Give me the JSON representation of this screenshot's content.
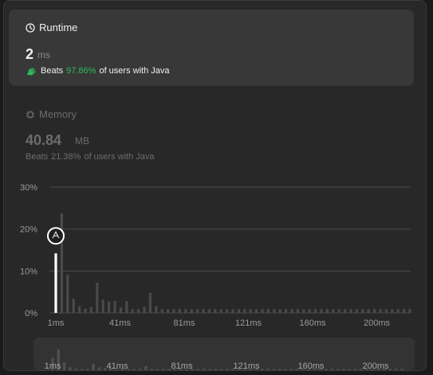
{
  "runtime": {
    "title": "Runtime",
    "value": "2",
    "unit": "ms",
    "beats_label": "Beats",
    "beats_pct": "97.86%",
    "beats_suffix": "of users with Java"
  },
  "memory": {
    "title": "Memory",
    "value": "40.84",
    "unit": "MB",
    "beats_label": "Beats",
    "beats_pct": "21.38%",
    "beats_suffix": "of users with Java"
  },
  "colors": {
    "accent_green": "#2cbb5d",
    "bar": "#4a4a4a",
    "highlight": "#ffffff"
  },
  "icons": {
    "runtime": "clock-icon",
    "memory": "chip-icon",
    "beats": "hand-clap-icon",
    "marker": "user-avatar-icon"
  },
  "chart_data": {
    "type": "bar",
    "xlabel": "",
    "ylabel": "",
    "ylim": [
      0,
      30
    ],
    "yticks": [
      "30%",
      "20%",
      "10%",
      "0%"
    ],
    "xticks": [
      "1ms",
      "41ms",
      "81ms",
      "121ms",
      "160ms",
      "200ms"
    ],
    "highlight_index": 0,
    "series": [
      {
        "values": [
          14.2,
          23.7,
          9.1,
          3.4,
          1.6,
          1.0,
          1.4,
          7.2,
          3.2,
          2.7,
          2.9,
          1.3,
          2.8,
          0.9,
          0.9,
          1.4,
          4.8,
          1.6,
          0.9,
          0.9,
          0.9,
          0.9,
          0.9,
          0.9,
          0.9,
          0.9,
          0.9,
          0.9,
          0.9,
          0.9,
          0.9,
          0.9,
          0.9,
          0.9,
          0.9,
          0.9,
          0.9,
          0.9,
          0.9,
          0.9,
          0.9,
          0.9,
          0.9,
          0.9,
          0.9,
          0.9,
          0.9,
          0.9,
          0.9,
          0.9,
          0.9,
          0.9,
          0.9,
          0.9,
          0.9,
          0.9,
          0.9,
          0.9,
          0.9,
          0.9,
          0.9
        ]
      }
    ]
  }
}
